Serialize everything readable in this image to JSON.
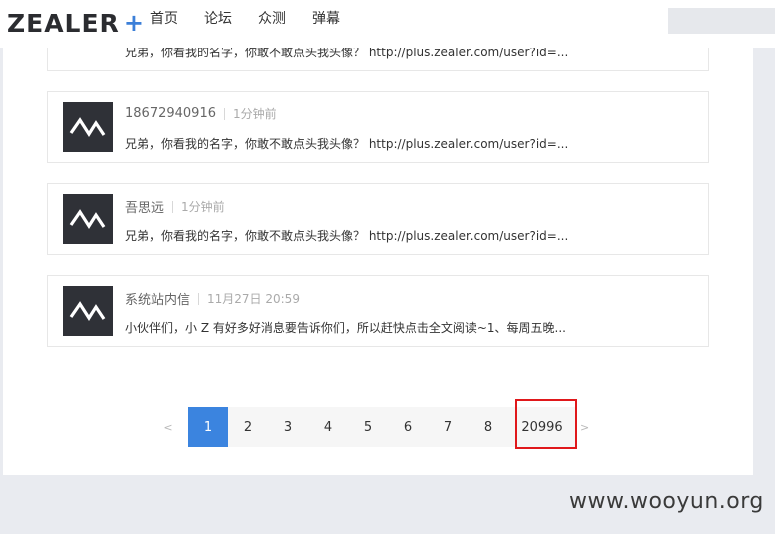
{
  "header": {
    "logo_text": "ZEALER",
    "logo_plus": "+",
    "nav": [
      "首页",
      "论坛",
      "众测",
      "弹幕"
    ],
    "search_placeholder": ""
  },
  "messages": [
    {
      "author": "",
      "time": "",
      "text": "兄弟，你看我的名字，你敢不敢点头我头像？ http://plus.zealer.com/user?id=...",
      "avatar": "photo"
    },
    {
      "author": "18672940916",
      "time": "1分钟前",
      "text": "兄弟，你看我的名字，你敢不敢点头我头像？ http://plus.zealer.com/user?id=...",
      "avatar": "zealer-logo"
    },
    {
      "author": "吾思远",
      "time": "1分钟前",
      "text": "兄弟，你看我的名字，你敢不敢点头我头像？ http://plus.zealer.com/user?id=...",
      "avatar": "zealer-logo"
    },
    {
      "author": "系统站内信",
      "time": "11月27日 20:59",
      "text": "小伙伴们，小 Z 有好多好消息要告诉你们，所以赶快点击全文阅读~1、每周五晚...",
      "avatar": "zealer-logo"
    }
  ],
  "pagination": {
    "prev": "<",
    "pages": [
      "1",
      "2",
      "3",
      "4",
      "5",
      "6",
      "7",
      "8"
    ],
    "last_page": "20996",
    "next": ">",
    "current": "1"
  },
  "watermark": "www.wooyun.org",
  "colors": {
    "accent": "#3b84df",
    "highlight": "#e0181b",
    "avatar_bg": "#2f3137"
  }
}
